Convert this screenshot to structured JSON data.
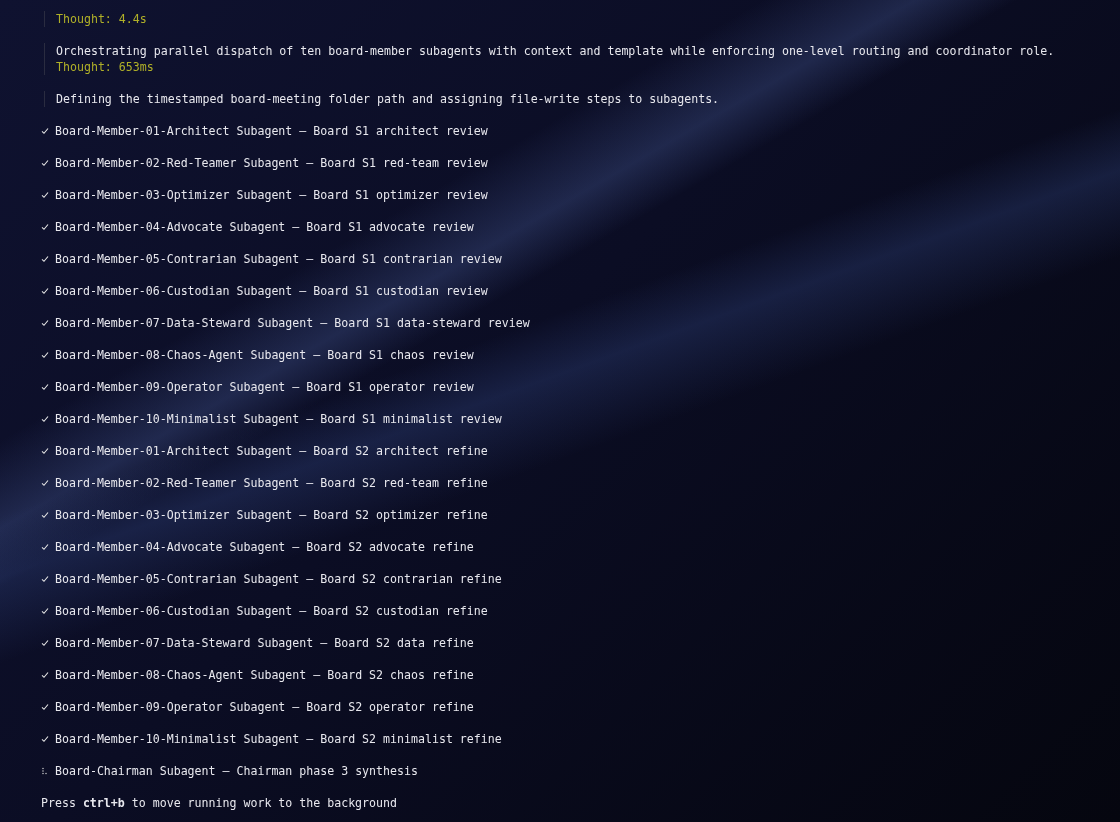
{
  "thoughts": [
    {
      "lines": [
        {
          "kind": "thought",
          "text": "Thought: 4.4s"
        }
      ]
    },
    {
      "lines": [
        {
          "kind": "note",
          "text": "Orchestrating parallel dispatch of ten board-member subagents with context and template while enforcing one-level routing and coordinator role."
        },
        {
          "kind": "thought",
          "text": "Thought: 653ms"
        }
      ]
    },
    {
      "lines": [
        {
          "kind": "note",
          "text": "Defining the timestamped board-meeting folder path and assigning file-write steps to subagents."
        }
      ]
    }
  ],
  "tasks": [
    {
      "kind": "done",
      "text": "Board-Member-01-Architect Subagent — Board S1 architect review"
    },
    {
      "kind": "done",
      "text": "Board-Member-02-Red-Teamer Subagent — Board S1 red-team review"
    },
    {
      "kind": "done",
      "text": "Board-Member-03-Optimizer Subagent — Board S1 optimizer review"
    },
    {
      "kind": "done",
      "text": "Board-Member-04-Advocate Subagent — Board S1 advocate review"
    },
    {
      "kind": "done",
      "text": "Board-Member-05-Contrarian Subagent — Board S1 contrarian review"
    },
    {
      "kind": "done",
      "text": "Board-Member-06-Custodian Subagent — Board S1 custodian review"
    },
    {
      "kind": "done",
      "text": "Board-Member-07-Data-Steward Subagent — Board S1 data-steward review"
    },
    {
      "kind": "done",
      "text": "Board-Member-08-Chaos-Agent Subagent — Board S1 chaos review"
    },
    {
      "kind": "done",
      "text": "Board-Member-09-Operator Subagent — Board S1 operator review"
    },
    {
      "kind": "done",
      "text": "Board-Member-10-Minimalist Subagent — Board S1 minimalist review"
    },
    {
      "kind": "done",
      "text": "Board-Member-01-Architect Subagent — Board S2 architect refine"
    },
    {
      "kind": "done",
      "text": "Board-Member-02-Red-Teamer Subagent — Board S2 red-team refine"
    },
    {
      "kind": "done",
      "text": "Board-Member-03-Optimizer Subagent — Board S2 optimizer refine"
    },
    {
      "kind": "done",
      "text": "Board-Member-04-Advocate Subagent — Board S2 advocate refine"
    },
    {
      "kind": "done",
      "text": "Board-Member-05-Contrarian Subagent — Board S2 contrarian refine"
    },
    {
      "kind": "done",
      "text": "Board-Member-06-Custodian Subagent — Board S2 custodian refine"
    },
    {
      "kind": "done",
      "text": "Board-Member-07-Data-Steward Subagent — Board S2 data refine"
    },
    {
      "kind": "done",
      "text": "Board-Member-08-Chaos-Agent Subagent — Board S2 chaos refine"
    },
    {
      "kind": "done",
      "text": "Board-Member-09-Operator Subagent — Board S2 operator refine"
    },
    {
      "kind": "done",
      "text": "Board-Member-10-Minimalist Subagent — Board S2 minimalist refine"
    },
    {
      "kind": "running",
      "text": "Board-Chairman Subagent — Chairman phase 3 synthesis"
    }
  ],
  "hint": "Press **ctrl+b** to move running work to the background"
}
